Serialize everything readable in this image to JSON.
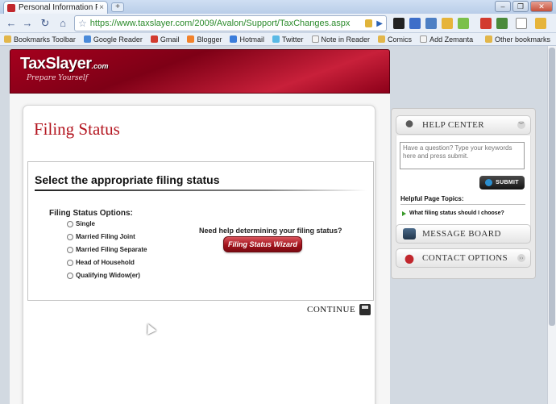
{
  "browser": {
    "tab_title": "Personal Information Filing ...",
    "tab_close": "×",
    "new_tab": "+",
    "url": "https://www.taxslayer.com/2009/Avalon/Support/TaxChanges.aspx",
    "back": "←",
    "forward": "→",
    "reload": "↻",
    "home": "⌂",
    "star": "☆",
    "go": "▶",
    "window_min": "–",
    "window_max": "❐",
    "window_close": "✕"
  },
  "bookmarks": [
    {
      "label": "Bookmarks Toolbar",
      "color": "#e2b64a"
    },
    {
      "label": "Google Reader",
      "color": "#4a8ad9"
    },
    {
      "label": "Gmail",
      "color": "#d23b2f"
    },
    {
      "label": "Blogger",
      "color": "#f2822b"
    },
    {
      "label": "Hotmail",
      "color": "#3b7ddb"
    },
    {
      "label": "Twitter",
      "color": "#5ab9e5"
    },
    {
      "label": "Note in Reader",
      "color": "#aaaaaa"
    },
    {
      "label": "Comics",
      "color": "#e2b64a"
    },
    {
      "label": "Add Zemanta",
      "color": "#aaaaaa"
    }
  ],
  "other_bookmarks": "Other bookmarks",
  "brand": {
    "logo_main": "TaxSlayer",
    "logo_suffix": ".com",
    "tagline": "Prepare Yourself",
    "accent": "#a5001e"
  },
  "page": {
    "title": "Filing Status",
    "heading": "Select the appropriate filing status",
    "options_label": "Filing Status Options:",
    "options": [
      "Single",
      "Married Filing Joint",
      "Married Filing Separate",
      "Head of Household",
      "Qualifying Widow(er)"
    ],
    "help_question": "Need help determining your filing status?",
    "wizard_button": "Filing Status Wizard",
    "continue": "CONTINUE"
  },
  "sidebar": {
    "help_center": "HELP CENTER",
    "help_placeholder": "Have a question? Type your keywords here and press submit.",
    "submit": "SUBMIT",
    "topics_label": "Helpful Page Topics:",
    "topic_link": "What filing status should I choose?",
    "message_board": "MESSAGE BOARD",
    "contact_options": "CONTACT OPTIONS"
  }
}
